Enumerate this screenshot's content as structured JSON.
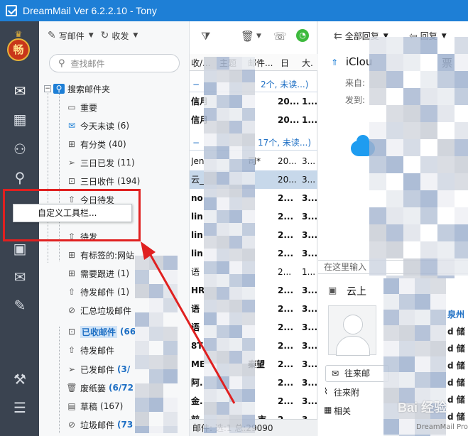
{
  "window": {
    "title": "DreamMail Ver 6.2.2.10  -  Tony"
  },
  "rail": {
    "avatar_char": "畅",
    "items": [
      {
        "icon": "mail-icon",
        "glyph": "✉"
      },
      {
        "icon": "calendar-icon",
        "glyph": "▦"
      },
      {
        "icon": "contacts-icon",
        "glyph": "⚇"
      },
      {
        "icon": "search-icon",
        "glyph": "⚲"
      },
      {
        "icon": "address-book-icon",
        "glyph": "▣"
      },
      {
        "icon": "mail-send-icon",
        "glyph": "✉"
      },
      {
        "icon": "edit-icon",
        "glyph": "✎"
      },
      {
        "icon": "wrench-icon",
        "glyph": "⚒"
      },
      {
        "icon": "menu-icon",
        "glyph": "☰"
      }
    ]
  },
  "folder_toolbar": {
    "compose": "写邮件",
    "receive": "收发"
  },
  "search": {
    "placeholder": "查找邮件"
  },
  "folders": {
    "root": "搜索邮件夹",
    "important": "重要",
    "today_unread": "今天未读",
    "today_unread_count": "(6)",
    "classified": "有分类",
    "classified_count": "(40)",
    "sent_3days": "三日已发",
    "sent_3days_count": "(11)",
    "received_3days": "三日收件",
    "received_3days_count": "(194)",
    "todo_today": "今日待发",
    "todo": "待发",
    "tagged": "有标签的:网站",
    "followup": "需要跟进",
    "followup_count": "(1)",
    "pending": "待发邮件",
    "pending_count": "(1)",
    "junk_summary": "汇总垃圾邮件",
    "inbox": "已收邮件",
    "inbox_count": "(66",
    "outbox": "待发邮件",
    "sent": "已发邮件",
    "sent_count": "(3/",
    "trash": "废纸篓",
    "trash_count": "(6/72",
    "drafts": "草稿",
    "drafts_count": "(167)",
    "spam": "垃圾邮件",
    "spam_count": "(73"
  },
  "context_menu": {
    "customize_toolbar": "自定义工具栏..."
  },
  "list": {
    "columns": [
      "收/...",
      "主题",
      "邮件...",
      "日",
      "大."
    ],
    "group1": "2个, 未读...)",
    "group2": "17个, 未读...)",
    "rows": [
      {
        "from": "信月",
        "subject": "",
        "size": "20...",
        "extra": "1..."
      },
      {
        "from": "信月",
        "subject": "",
        "size": "20...",
        "extra": "1..."
      },
      {
        "from": "Jen",
        "subject": "司*",
        "size": "20...",
        "extra": "3..."
      },
      {
        "from": "云_",
        "subject": "",
        "size": "20...",
        "extra": "3..."
      },
      {
        "from": "no",
        "subject": "",
        "size": "2...",
        "extra": "3..."
      },
      {
        "from": "lin",
        "subject": "",
        "size": "2...",
        "extra": "3..."
      },
      {
        "from": "lin",
        "subject": "",
        "size": "2...",
        "extra": "3..."
      },
      {
        "from": "lin",
        "subject": "",
        "size": "2...",
        "extra": "3..."
      },
      {
        "from": "语",
        "subject": "",
        "size": "2...",
        "extra": "1..."
      },
      {
        "from": "HR",
        "subject": "",
        "size": "2...",
        "extra": "3..."
      },
      {
        "from": "语",
        "subject": "",
        "size": "2...",
        "extra": "3..."
      },
      {
        "from": "语",
        "subject": "",
        "size": "2...",
        "extra": "3..."
      },
      {
        "from": "8T",
        "subject": "",
        "size": "2...",
        "extra": "3..."
      },
      {
        "from": "ME",
        "subject": "",
        "size": "2...",
        "extra": "3..."
      },
      {
        "from": "阿.",
        "subject": "",
        "size": "2...",
        "extra": "3..."
      },
      {
        "from": "金.",
        "subject": "",
        "size": "2...",
        "extra": "3..."
      },
      {
        "from": "前.",
        "subject": "",
        "size": "2...",
        "extra": "3..."
      }
    ],
    "subject_fragments": {
      "r14": "秦望",
      "r17": "市"
    },
    "status": "邮件: 选:1 总:29090"
  },
  "reader": {
    "reply_all": "全部回复",
    "reply": "回复",
    "subject": "iClou",
    "subject_tail": "票",
    "from_label": "来自:",
    "to_label": "发到:",
    "reply_hint": "在这里输入",
    "contact_name": "云上",
    "contact_button": "往来邮",
    "link_attachments": "往来附",
    "link_related": "相关",
    "side_tags": [
      "泉州",
      "d 储",
      "d 储",
      "d 储",
      "d 储",
      "d 储",
      "d 储"
    ],
    "brand_footer": "DreamMail Pro"
  },
  "watermark": {
    "text": "Bai 经验"
  },
  "colors": {
    "titlebar": "#1e7fd6",
    "rail": "#3a4350",
    "highlight": "#e02020",
    "link": "#1e6fc4"
  }
}
